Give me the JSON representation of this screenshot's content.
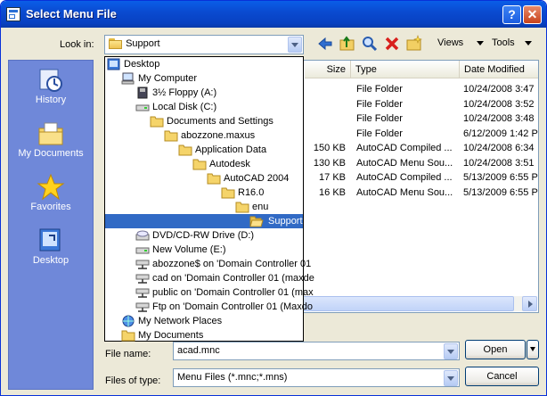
{
  "window": {
    "title": "Select Menu File",
    "help_label": "?",
    "close_label": "✕"
  },
  "lookin": {
    "label": "Look in:",
    "value": "Support"
  },
  "toolbar": {
    "views_label": "Views",
    "tools_label": "Tools"
  },
  "places": [
    {
      "label": "History",
      "icon": "history-icon"
    },
    {
      "label": "My Documents",
      "icon": "my-documents-icon"
    },
    {
      "label": "Favorites",
      "icon": "favorites-icon"
    },
    {
      "label": "Desktop",
      "icon": "desktop-icon"
    }
  ],
  "columns": {
    "size": "Size",
    "type": "Type",
    "date": "Date Modified"
  },
  "rows": [
    {
      "size": "",
      "type": "File Folder",
      "date": "10/24/2008 3:47"
    },
    {
      "size": "",
      "type": "File Folder",
      "date": "10/24/2008 3:52"
    },
    {
      "size": "",
      "type": "File Folder",
      "date": "10/24/2008 3:48"
    },
    {
      "size": "",
      "type": "File Folder",
      "date": "6/12/2009 1:42 P"
    },
    {
      "size": "150 KB",
      "type": "AutoCAD Compiled ...",
      "date": "10/24/2008 6:34"
    },
    {
      "size": "130 KB",
      "type": "AutoCAD Menu Sou...",
      "date": "10/24/2008 3:51"
    },
    {
      "size": "17 KB",
      "type": "AutoCAD Compiled ...",
      "date": "5/13/2009 6:55 P"
    },
    {
      "size": "16 KB",
      "type": "AutoCAD Menu Sou...",
      "date": "5/13/2009 6:55 P"
    }
  ],
  "tree": [
    {
      "label": "Desktop",
      "indent": 0,
      "icon": "desktop-icon"
    },
    {
      "label": "My Computer",
      "indent": 1,
      "icon": "computer-icon"
    },
    {
      "label": "3½ Floppy (A:)",
      "indent": 2,
      "icon": "floppy-icon"
    },
    {
      "label": "Local Disk (C:)",
      "indent": 2,
      "icon": "drive-icon"
    },
    {
      "label": "Documents and Settings",
      "indent": 3,
      "icon": "folder-icon"
    },
    {
      "label": "abozzone.maxus",
      "indent": 4,
      "icon": "folder-icon"
    },
    {
      "label": "Application Data",
      "indent": 5,
      "icon": "folder-icon"
    },
    {
      "label": "Autodesk",
      "indent": 6,
      "icon": "folder-icon"
    },
    {
      "label": "AutoCAD 2004",
      "indent": 7,
      "icon": "folder-icon"
    },
    {
      "label": "R16.0",
      "indent": 8,
      "icon": "folder-icon"
    },
    {
      "label": "enu",
      "indent": 9,
      "icon": "folder-icon"
    },
    {
      "label": "Support",
      "indent": 10,
      "icon": "folder-open-icon",
      "selected": true
    },
    {
      "label": "DVD/CD-RW Drive (D:)",
      "indent": 2,
      "icon": "cd-drive-icon"
    },
    {
      "label": "New Volume (E:)",
      "indent": 2,
      "icon": "drive-icon"
    },
    {
      "label": "abozzone$ on 'Domain Controller 01",
      "indent": 2,
      "icon": "network-drive-icon"
    },
    {
      "label": "cad on 'Domain Controller 01 (maxde",
      "indent": 2,
      "icon": "network-drive-icon"
    },
    {
      "label": "public on 'Domain Controller 01 (max",
      "indent": 2,
      "icon": "network-drive-icon"
    },
    {
      "label": "Ftp on 'Domain Controller 01 (Maxdo",
      "indent": 2,
      "icon": "network-drive-icon"
    },
    {
      "label": "My Network Places",
      "indent": 1,
      "icon": "network-places-icon"
    },
    {
      "label": "My Documents",
      "indent": 1,
      "icon": "folder-icon"
    }
  ],
  "filename": {
    "label": "File name:",
    "value": "acad.mnc"
  },
  "filetype": {
    "label": "Files of type:",
    "value": "Menu Files (*.mnc;*.mns)"
  },
  "buttons": {
    "open": "Open",
    "cancel": "Cancel"
  }
}
